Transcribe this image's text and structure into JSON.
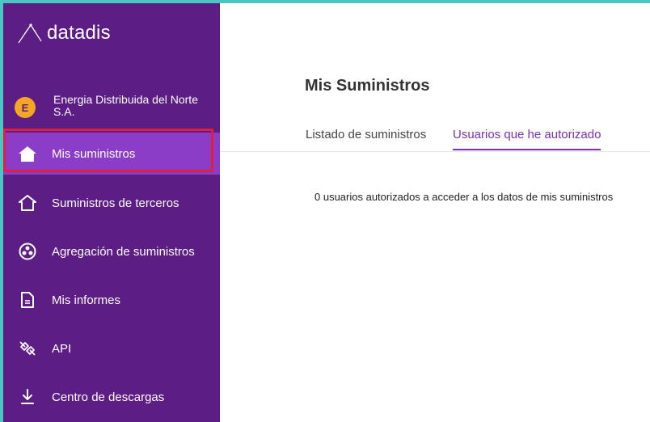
{
  "brand": {
    "name": "datadis"
  },
  "account": {
    "initial": "E",
    "name": "Energia Distribuida del Norte S.A."
  },
  "nav": {
    "items": [
      {
        "label": "Mis suministros",
        "icon": "home-filled-icon",
        "active": true
      },
      {
        "label": "Suministros de terceros",
        "icon": "home-outline-icon"
      },
      {
        "label": "Agregación de suministros",
        "icon": "aggregation-icon"
      },
      {
        "label": "Mis informes",
        "icon": "document-icon"
      },
      {
        "label": "API",
        "icon": "plug-icon"
      },
      {
        "label": "Centro de descargas",
        "icon": "download-icon"
      }
    ]
  },
  "main": {
    "title": "Mis Suministros",
    "tabs": [
      {
        "label": "Listado de suministros",
        "active": false
      },
      {
        "label": "Usuarios que he autorizado",
        "active": true
      }
    ],
    "empty_message": "0 usuarios autorizados a acceder a los datos de mis suministros"
  },
  "colors": {
    "sidebar": "#5c1d85",
    "active_item": "#8b3dc7",
    "accent": "#7a2fb5",
    "avatar": "#f5a623",
    "highlight": "#e0203a",
    "frame": "#4cc6c3"
  }
}
